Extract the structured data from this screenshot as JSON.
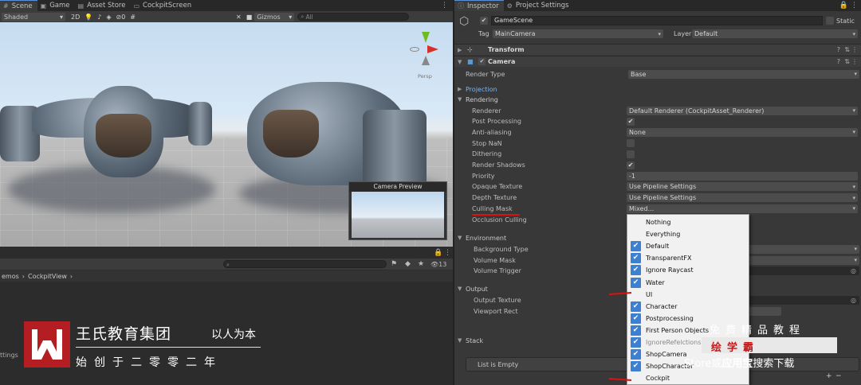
{
  "left_tabs": [
    {
      "label": "Scene",
      "icon": "scene-icon"
    },
    {
      "label": "Game",
      "icon": "game-icon"
    },
    {
      "label": "Asset Store",
      "icon": "store-icon"
    },
    {
      "label": "CockpitScreen",
      "icon": "screen-icon"
    }
  ],
  "scene_toolbar": {
    "shading": "Shaded",
    "mode_2d": "2D",
    "gizmos": "Gizmos",
    "search_placeholder": "All",
    "layers_count": "0"
  },
  "gizmo": {
    "label": "Persp"
  },
  "camera_preview": {
    "title": "Camera Preview"
  },
  "project_panel": {
    "count": "13",
    "breadcrumb": [
      "emos",
      "CockpitView"
    ]
  },
  "watermark": {
    "title": "王氏教育集团",
    "motto": "以人为本",
    "subtitle": "始创于二零零二年",
    "side_text": "ttings",
    "promo1": "免费精品教程",
    "promo2": "绘学霸",
    "promo3a": "Store",
    "promo3b": "或",
    "promo3c": "应用宝",
    "promo3d": "搜索下载"
  },
  "right_tabs": [
    {
      "label": "Inspector",
      "icon": "info-icon"
    },
    {
      "label": "Project Settings",
      "icon": "gear-icon"
    }
  ],
  "inspector": {
    "object_name": "GameScene",
    "static_label": "Static",
    "tag_label": "Tag",
    "tag_value": "MainCamera",
    "layer_label": "Layer",
    "layer_value": "Default",
    "transform": "Transform",
    "camera": "Camera",
    "render_type_label": "Render Type",
    "render_type_value": "Base",
    "projection": "Projection",
    "rendering": "Rendering",
    "rows": [
      {
        "label": "Renderer",
        "value": "Default Renderer (CockpitAsset_Renderer)",
        "kind": "dropdown"
      },
      {
        "label": "Post Processing",
        "value": "✔",
        "kind": "check"
      },
      {
        "label": "Anti-aliasing",
        "value": "None",
        "kind": "dropdown"
      },
      {
        "label": "Stop NaN",
        "value": "",
        "kind": "check"
      },
      {
        "label": "Dithering",
        "value": "",
        "kind": "check"
      },
      {
        "label": "Render Shadows",
        "value": "✔",
        "kind": "check"
      },
      {
        "label": "Priority",
        "value": "-1",
        "kind": "field"
      },
      {
        "label": "Opaque Texture",
        "value": "Use Pipeline Settings",
        "kind": "dropdown"
      },
      {
        "label": "Depth Texture",
        "value": "Use Pipeline Settings",
        "kind": "dropdown"
      },
      {
        "label": "Culling Mask",
        "value": "Mixed...",
        "kind": "dropdown"
      },
      {
        "label": "Occlusion Culling",
        "value": "",
        "kind": "none"
      }
    ],
    "environment": "Environment",
    "env_rows": [
      "Background Type",
      "Volume Mask",
      "Volume Trigger"
    ],
    "output": "Output",
    "output_rows": [
      "Output Texture",
      "Viewport Rect"
    ],
    "stack": "Stack",
    "stack_empty": "List is Empty"
  },
  "culling_menu": [
    {
      "label": "Nothing",
      "checked": false
    },
    {
      "label": "Everything",
      "checked": false
    },
    {
      "label": "Default",
      "checked": true
    },
    {
      "label": "TransparentFX",
      "checked": true
    },
    {
      "label": "Ignore Raycast",
      "checked": true
    },
    {
      "label": "Water",
      "checked": true
    },
    {
      "label": "UI",
      "checked": false
    },
    {
      "label": "Character",
      "checked": true
    },
    {
      "label": "Postprocessing",
      "checked": true
    },
    {
      "label": "First Person Objects",
      "checked": true
    },
    {
      "label": "IgnoreRefelctions",
      "checked": true
    },
    {
      "label": "ShopCamera",
      "checked": true
    },
    {
      "label": "ShopCharacter",
      "checked": true
    },
    {
      "label": "Cockpit",
      "checked": false
    }
  ],
  "colors": {
    "accent": "#3d7fd0",
    "brand_red": "#b41d22",
    "annotation": "#dd1111"
  }
}
